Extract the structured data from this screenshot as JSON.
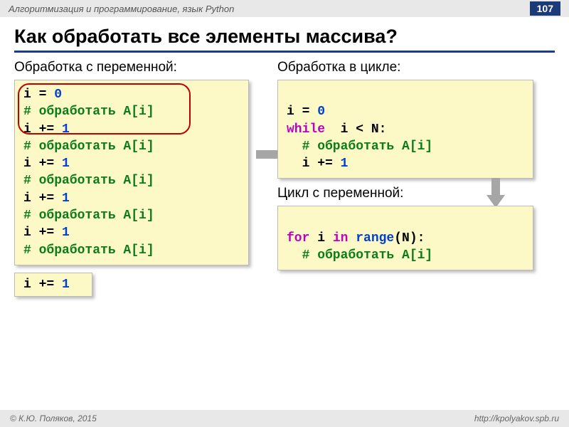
{
  "topbar": {
    "breadcrumb": "Алгоритмизация и программирование, язык Python",
    "page": "107"
  },
  "title": "Как обработать все элементы массива?",
  "left": {
    "heading": "Обработка с переменной:",
    "code": {
      "l1a": "i = ",
      "l1b": "0",
      "l2": "# обработать A[i]",
      "l3a": "i += ",
      "l3b": "1",
      "l4": "# обработать A[i]",
      "l5a": "i += ",
      "l5b": "1",
      "l6": "# обработать A[i]",
      "l7a": "i += ",
      "l7b": "1",
      "l8": "# обработать A[i]",
      "l9a": "i += ",
      "l9b": "1",
      "l10": "# обработать A[i]"
    },
    "tail": {
      "a": "i += ",
      "b": "1"
    }
  },
  "right": {
    "heading1": "Обработка в цикле:",
    "code1": {
      "l1a": "i = ",
      "l1b": "0",
      "l2a": "while",
      "l2b": "  i < N:",
      "l3": "  # обработать A[i]",
      "l4a": "  i += ",
      "l4b": "1"
    },
    "heading2": "Цикл с переменной:",
    "code2": {
      "l1a": "for",
      "l1b": " i ",
      "l1c": "in",
      "l1d": " range",
      "l1e": "(N):",
      "l2": "  # обработать A[i]"
    }
  },
  "footer": {
    "left": "© К.Ю. Поляков, 2015",
    "right": "http://kpolyakov.spb.ru"
  }
}
